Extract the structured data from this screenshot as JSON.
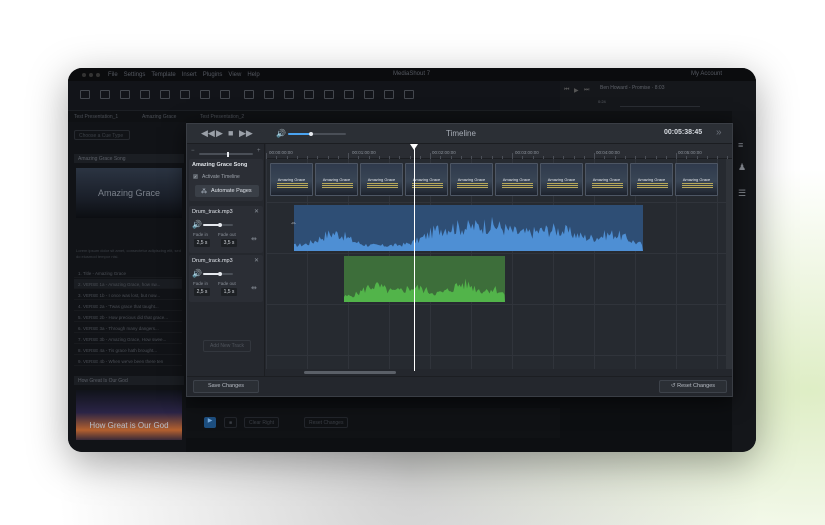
{
  "app": {
    "window_title": "MediaShout 7",
    "menu": [
      "File",
      "Settings",
      "Template",
      "Insert",
      "Plugins",
      "View",
      "Help"
    ],
    "account": "My Account"
  },
  "player": {
    "song": "Ben Howard - Promise",
    "duration": "8:03",
    "elapsed": "0:24"
  },
  "tabs": {
    "presentation": "Test Presentation_1",
    "song_tab": "Amazing Grace",
    "presentation2": "Test Presentation_2"
  },
  "left_panel": {
    "choose_btn": "Choose a Cue Type",
    "song_header": "Amazing Grace Song",
    "thumb_text": "Amazing Grace",
    "lyrics_preview": "Lorem ipsum dolor sit amet, consectetur adipiscing elit, sed do eiusmod tempor nisi.",
    "lines": [
      "1. Title - Amazing Grace",
      "2. VERSE 1a - Amazing Grace, how sw...",
      "3. VERSE 1b - I once was lost, but now...",
      "4. VERSE 2a - 'Twas grace that taught...",
      "5. VERSE 2b - How precious did that grace...",
      "6. VERSE 3a - Through many dangers...",
      "7. VERSE 3b - Amazing Grace, How swee...",
      "8. VERSE 4a - Tis grace hath brought...",
      "9. VERSE 4b - When we've been there ten"
    ],
    "second_header": "How Great Is Our God",
    "second_thumb": "How Great is Our God"
  },
  "bottom_bar": {
    "clear_btn": "Clear Right",
    "reset_btn": "Reset Changes"
  },
  "timeline": {
    "title": "Timeline",
    "time": "00:05:38:45",
    "ruler": [
      "00:00:00:00",
      "00:01:00:00",
      "00:02:00:00",
      "00:03:00:00",
      "00:04:00:00",
      "00:05:00:00"
    ],
    "song": {
      "title": "Amazing Grace Song",
      "activate_label": "Activate Timeline",
      "automate_label": "Automate Pages"
    },
    "tracks": [
      {
        "name": "Drum_track.mp3",
        "fade_in_label": "Fade in",
        "fade_out_label": "Fade out",
        "fade_in": "2,5 s",
        "fade_out": "3,5 s",
        "volume": 0.55
      },
      {
        "name": "Drum_track.mp3",
        "fade_in_label": "Fade in",
        "fade_out_label": "Fade out",
        "fade_in": "2,5 s",
        "fade_out": "1,5 s",
        "volume": 0.55
      }
    ],
    "add_track": "Add New Track",
    "slide_label": "Amazing Grace",
    "save_btn": "Save Changes",
    "reset_btn": "Reset Changes",
    "master_volume": 0.4
  },
  "colors": {
    "accent": "#4aa3f0",
    "blue_wave": "#4e8fd4",
    "green_wave": "#52b44a"
  }
}
